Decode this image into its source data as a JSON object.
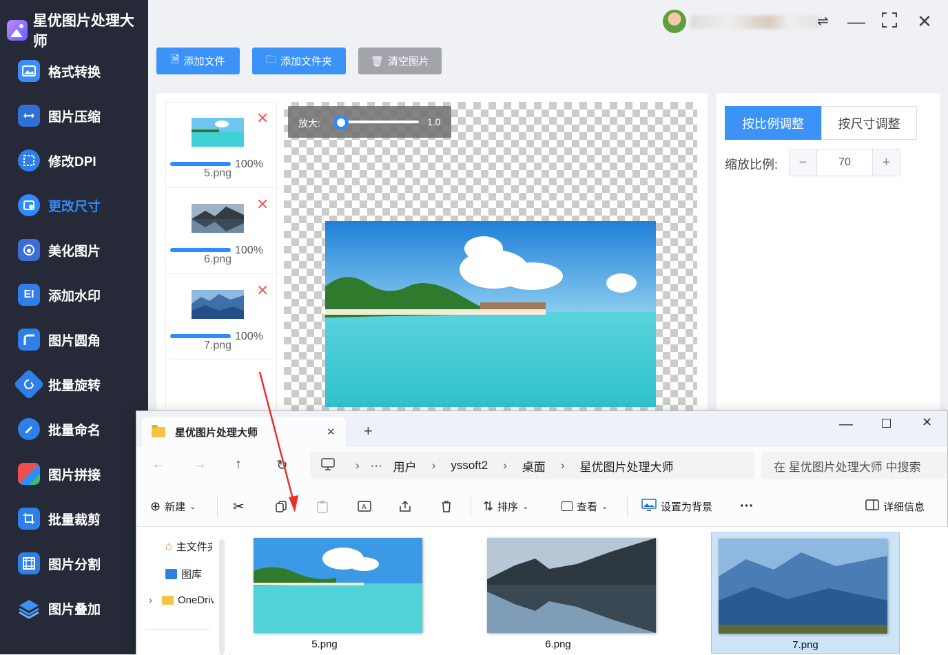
{
  "app": {
    "title": "星优图片处理大师"
  },
  "sidebar": {
    "items": [
      {
        "label": "格式转换",
        "icon": "image-convert-icon"
      },
      {
        "label": "图片压缩",
        "icon": "compress-icon"
      },
      {
        "label": "修改DPI",
        "icon": "dpi-icon"
      },
      {
        "label": "更改尺寸",
        "icon": "resize-icon",
        "active": true
      },
      {
        "label": "美化图片",
        "icon": "beautify-icon"
      },
      {
        "label": "添加水印",
        "icon": "watermark-icon"
      },
      {
        "label": "图片圆角",
        "icon": "round-corner-icon"
      },
      {
        "label": "批量旋转",
        "icon": "rotate-icon"
      },
      {
        "label": "批量命名",
        "icon": "rename-icon"
      },
      {
        "label": "图片拼接",
        "icon": "puzzle-icon"
      },
      {
        "label": "批量裁剪",
        "icon": "crop-icon"
      },
      {
        "label": "图片分割",
        "icon": "split-icon"
      },
      {
        "label": "图片叠加",
        "icon": "layers-icon"
      }
    ]
  },
  "toolbar": {
    "add_file": "添加文件",
    "add_folder": "添加文件夹",
    "clear": "清空图片"
  },
  "files": [
    {
      "name": "5.png",
      "progress_label": "100%",
      "progress": 1.0
    },
    {
      "name": "6.png",
      "progress_label": "100%",
      "progress": 1.0
    },
    {
      "name": "7.png",
      "progress_label": "100%",
      "progress": 1.0
    }
  ],
  "zoom": {
    "label": "放大:",
    "value": "1.0"
  },
  "settings": {
    "tab_ratio": "按比例调整",
    "tab_size": "按尺寸调整",
    "scale_label": "缩放比例:",
    "scale_value": "70",
    "minus": "−",
    "plus": "+"
  },
  "explorer": {
    "tab_title": "星优图片处理大师",
    "breadcrumb": [
      "用户",
      "yssoft2",
      "桌面",
      "星优图片处理大师"
    ],
    "search_placeholder": "在 星优图片处理大师 中搜索",
    "toolbar": {
      "new": "新建",
      "sort": "排序",
      "view": "查看",
      "set_bg": "设置为背景",
      "details": "详细信息"
    },
    "nav": [
      "主文件夹",
      "图库",
      "OneDrive"
    ],
    "files": [
      {
        "name": "5.png"
      },
      {
        "name": "6.png"
      },
      {
        "name": "7.png",
        "selected": true
      }
    ]
  },
  "colors": {
    "accent": "#2f8bff",
    "sidebar": "#262a38",
    "danger": "#f06060",
    "arrow": "#e8302a"
  }
}
